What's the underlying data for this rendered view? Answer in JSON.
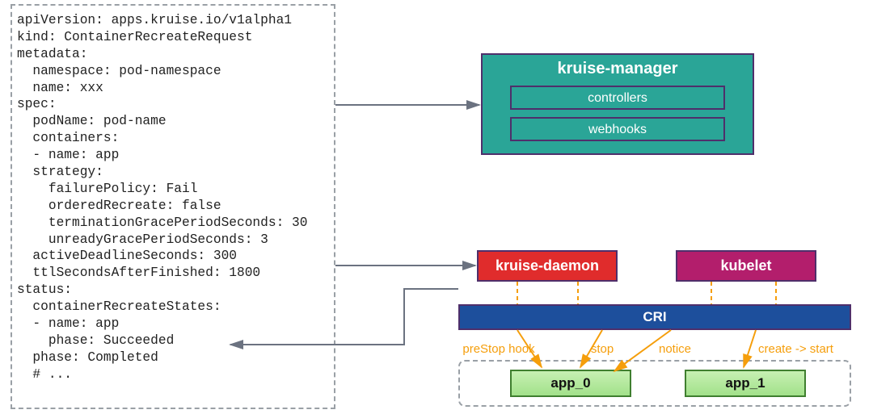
{
  "yaml": {
    "lines": [
      "apiVersion: apps.kruise.io/v1alpha1",
      "kind: ContainerRecreateRequest",
      "metadata:",
      "  namespace: pod-namespace",
      "  name: xxx",
      "spec:",
      "  podName: pod-name",
      "  containers:",
      "  - name: app",
      "  strategy:",
      "    failurePolicy: Fail",
      "    orderedRecreate: false",
      "    terminationGracePeriodSeconds: 30",
      "    unreadyGracePeriodSeconds: 3",
      "  activeDeadlineSeconds: 300",
      "  ttlSecondsAfterFinished: 1800",
      "status:",
      "  containerRecreateStates:",
      "  - name: app",
      "    phase: Succeeded",
      "  phase: Completed",
      "  # ..."
    ]
  },
  "manager": {
    "title": "kruise-manager",
    "sub1": "controllers",
    "sub2": "webhooks"
  },
  "daemon": "kruise-daemon",
  "kubelet": "kubelet",
  "cri": "CRI",
  "apps": {
    "a0": "app_0",
    "a1": "app_1"
  },
  "edges": {
    "prestop": "preStop hook",
    "stop": "stop",
    "notice": "notice",
    "createstart": "create -> start"
  },
  "colors": {
    "teal": "#2aa597",
    "red": "#e02c2c",
    "magenta": "#b31e6c",
    "blue": "#1d4f9c",
    "green": "#a2e18a",
    "orange": "#f59e0b",
    "grayArrow": "#6b7280"
  }
}
